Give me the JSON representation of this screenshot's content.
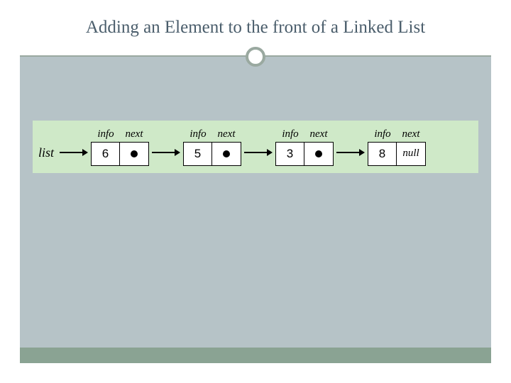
{
  "title": "Adding an Element to the front of a Linked List",
  "list_label": "list",
  "field_labels": {
    "info": "info",
    "next": "next"
  },
  "null_label": "null",
  "nodes": [
    {
      "info": "6",
      "has_next": true
    },
    {
      "info": "5",
      "has_next": true
    },
    {
      "info": "3",
      "has_next": true
    },
    {
      "info": "8",
      "has_next": false
    }
  ],
  "chart_data": {
    "type": "diagram",
    "structure": "singly-linked-list",
    "head_pointer": "list",
    "sequence": [
      6,
      5,
      3,
      8
    ],
    "terminator": "null"
  }
}
